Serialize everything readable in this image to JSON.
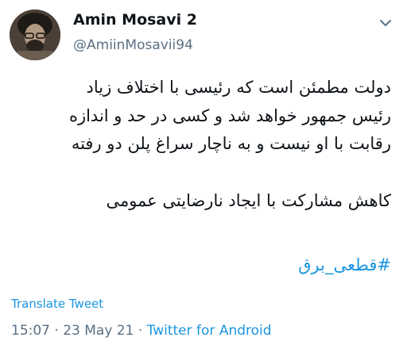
{
  "tweet": {
    "author_name": "Amin Mosavi 2",
    "author_handle": "@AmiinMosavii94",
    "lines": [
      "دولت مطمئن است که رئیسی با اختلاف زیاد",
      "رئیس جمهور خواهد شد و کسی در حد و اندازه",
      "رقابت با او نیست و به ناچار سراغ پلن دو رفته",
      "کاهش مشارکت با ایجاد نارضایتی عمومی"
    ],
    "hashtag": "#قطعی_برق",
    "translate_label": "Translate Tweet",
    "time": "15:07",
    "date": "23 May 21",
    "separator": "·",
    "source": "Twitter for Android"
  },
  "icons": {
    "more": "chevron-down-icon",
    "avatar": "avatar"
  },
  "colors": {
    "link": "#1b95e0",
    "secondary_text": "#5b7083",
    "primary_text": "#0f1419"
  }
}
